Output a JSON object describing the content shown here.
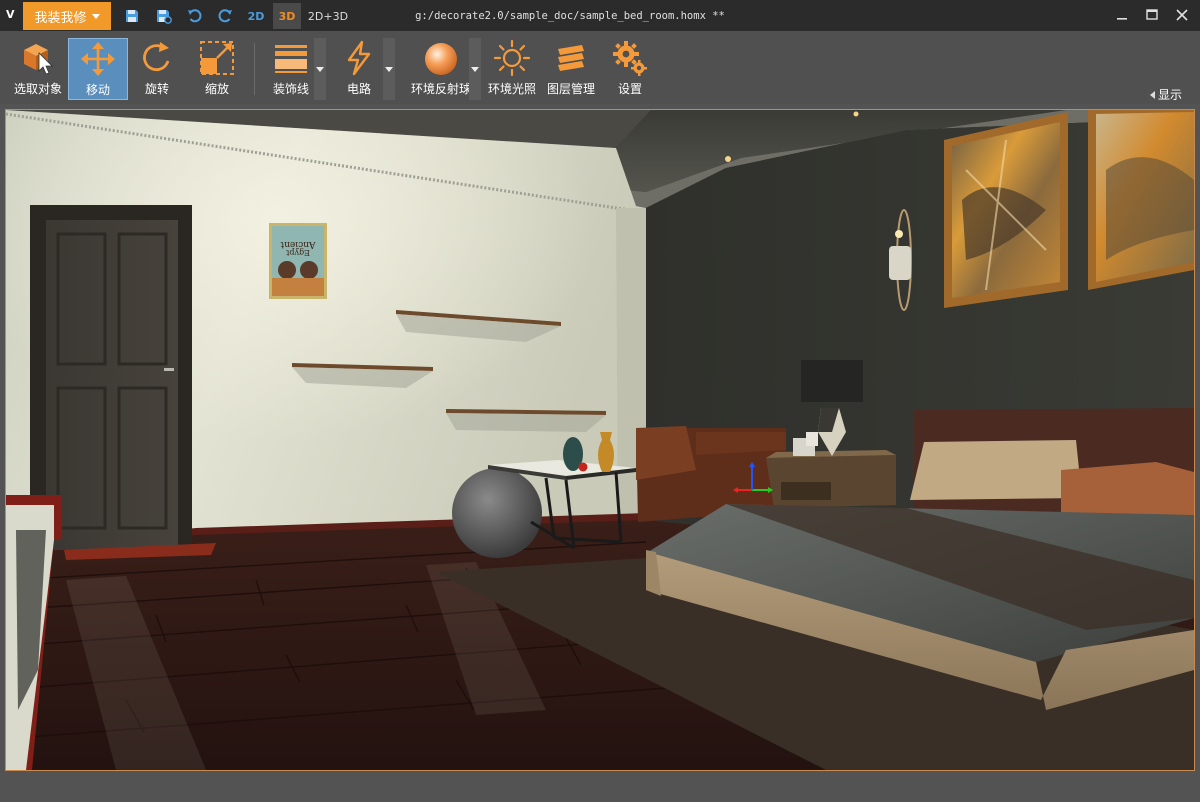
{
  "titlebar": {
    "logo": "V",
    "menu_label": "我装我修",
    "modes": {
      "mode_2d": "2D",
      "mode_3d": "3D",
      "mode_2d3d": "2D+3D"
    },
    "active_mode": "3D",
    "document_title": "g:/decorate2.0/sample_doc/sample_bed_room.homx **"
  },
  "toolbar": {
    "tools": [
      {
        "id": "select",
        "label": "选取对象"
      },
      {
        "id": "move",
        "label": "移动",
        "active": true
      },
      {
        "id": "rotate",
        "label": "旋转"
      },
      {
        "id": "scale",
        "label": "缩放"
      },
      {
        "id": "molding",
        "label": "装饰线"
      },
      {
        "id": "circuit",
        "label": "电路"
      },
      {
        "id": "env_sphere",
        "label": "环境反射球"
      },
      {
        "id": "env_light",
        "label": "环境光照"
      },
      {
        "id": "layers",
        "label": "图层管理"
      },
      {
        "id": "settings",
        "label": "设置"
      }
    ],
    "show_label": "显示"
  },
  "colors": {
    "accent_orange": "#f19a2a",
    "active_blue": "#5a8fbd",
    "mode_blue": "#4a9ce0",
    "toolbar_bg": "#505050",
    "titlebar_bg": "#2b2b2b",
    "viewport_border": "#c98a4f"
  },
  "icons": {
    "quick": [
      "save-icon",
      "save-as-icon",
      "undo-icon",
      "redo-icon"
    ],
    "window": [
      "minimize-icon",
      "maximize-icon",
      "close-icon"
    ]
  },
  "scene": {
    "poster_lines": [
      "Ancient",
      "Egypt"
    ]
  }
}
